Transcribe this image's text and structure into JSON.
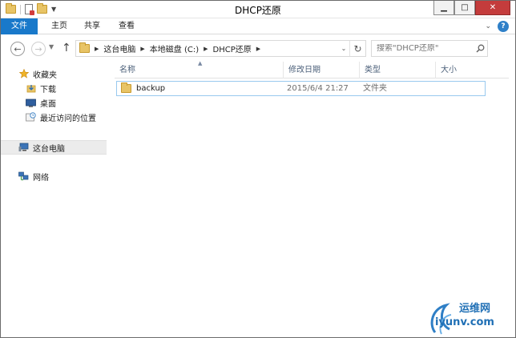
{
  "window": {
    "title": "DHCP还原"
  },
  "ribbon": {
    "tabs": [
      {
        "label": "文件"
      },
      {
        "label": "主页"
      },
      {
        "label": "共享"
      },
      {
        "label": "查看"
      }
    ],
    "help_label": "?"
  },
  "nav": {
    "address_path": [
      "这台电脑",
      "本地磁盘 (C:)",
      "DHCP还原"
    ],
    "search_placeholder": "搜索\"DHCP还原\""
  },
  "nav_pane": {
    "favorites_label": "收藏夹",
    "favorites": [
      {
        "label": "下载",
        "icon": "download-folder-icon"
      },
      {
        "label": "桌面",
        "icon": "desktop-icon"
      },
      {
        "label": "最近访问的位置",
        "icon": "recent-places-icon"
      }
    ],
    "this_pc_label": "这台电脑",
    "network_label": "网络"
  },
  "content": {
    "columns": {
      "name": "名称",
      "date": "修改日期",
      "type": "类型",
      "size": "大小"
    },
    "files": [
      {
        "name": "backup",
        "date": "2015/6/4 21:27",
        "type": "文件夹",
        "size": ""
      }
    ]
  },
  "watermark": {
    "text_cn": "运维网",
    "url": "iyunv.com"
  },
  "colors": {
    "file_tab_bg": "#1979ca",
    "selection_border": "#99c9ef",
    "column_header_text": "#4c607a",
    "close_button": "#c43c3c"
  }
}
